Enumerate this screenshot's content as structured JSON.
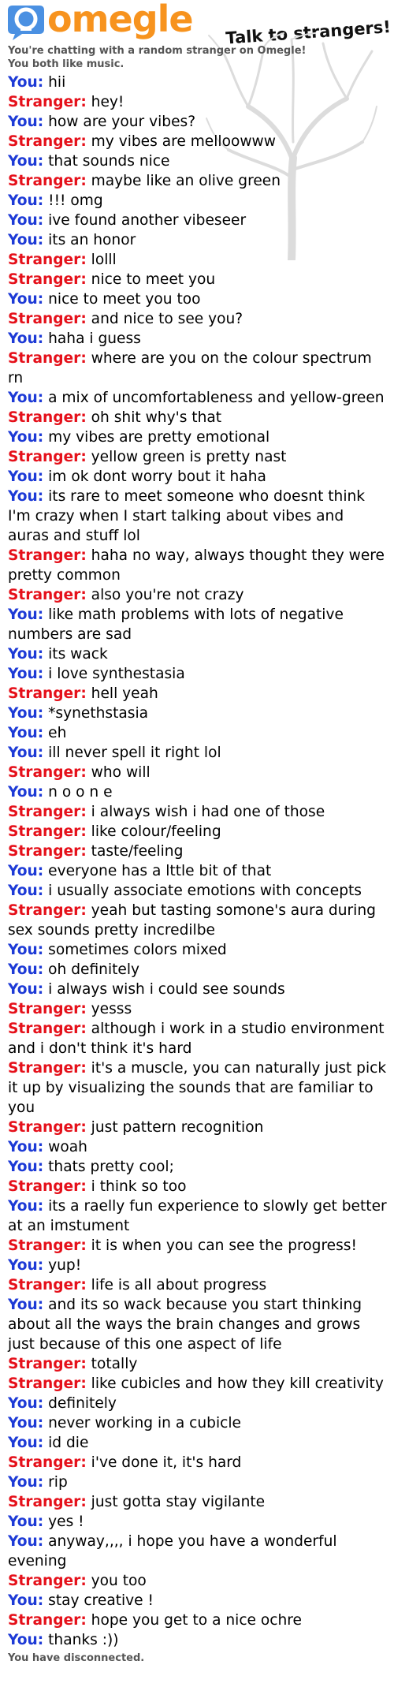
{
  "header": {
    "logo_text": "omegle",
    "tagline": "Talk to strangers!"
  },
  "system": {
    "intro": "You're chatting with a random stranger on Omegle!",
    "common_interest": "You both like music.",
    "disconnected": "You have disconnected."
  },
  "labels": {
    "you": "You:",
    "stranger": "Stranger:"
  },
  "colors": {
    "you": "#1d3ad6",
    "stranger": "#e5101a",
    "logo": "#f7931e",
    "logo_bubble": "#4a90e2"
  },
  "messages": [
    {
      "from": "you",
      "text": "hii"
    },
    {
      "from": "stranger",
      "text": "hey!"
    },
    {
      "from": "you",
      "text": "how are your vibes?"
    },
    {
      "from": "stranger",
      "text": "my vibes are melloowww"
    },
    {
      "from": "you",
      "text": "that sounds nice"
    },
    {
      "from": "stranger",
      "text": "maybe like an olive green"
    },
    {
      "from": "you",
      "text": "!!! omg"
    },
    {
      "from": "you",
      "text": "ive found another vibeseer"
    },
    {
      "from": "you",
      "text": "its an honor"
    },
    {
      "from": "stranger",
      "text": "lolll"
    },
    {
      "from": "stranger",
      "text": "nice to meet you"
    },
    {
      "from": "you",
      "text": "nice to meet you too"
    },
    {
      "from": "stranger",
      "text": "and nice to see you?"
    },
    {
      "from": "you",
      "text": "haha i guess"
    },
    {
      "from": "stranger",
      "text": "where are you on the colour spectrum rn"
    },
    {
      "from": "you",
      "text": "a mix of uncomfortableness and yellow-green"
    },
    {
      "from": "stranger",
      "text": "oh shit why's that"
    },
    {
      "from": "you",
      "text": "my vibes are pretty emotional"
    },
    {
      "from": "stranger",
      "text": "yellow green is pretty nast"
    },
    {
      "from": "you",
      "text": "im ok dont worry bout it haha"
    },
    {
      "from": "you",
      "text": "its rare to meet someone who doesnt think I'm crazy when I start talking about vibes and auras and stuff lol"
    },
    {
      "from": "stranger",
      "text": "haha no way, always thought they were pretty common"
    },
    {
      "from": "stranger",
      "text": "also you're not crazy"
    },
    {
      "from": "you",
      "text": "like math problems with lots of negative numbers are sad"
    },
    {
      "from": "you",
      "text": "its wack"
    },
    {
      "from": "you",
      "text": "i love synthestasia"
    },
    {
      "from": "stranger",
      "text": "hell yeah"
    },
    {
      "from": "you",
      "text": "*synethstasia"
    },
    {
      "from": "you",
      "text": "eh"
    },
    {
      "from": "you",
      "text": "ill never spell it right lol"
    },
    {
      "from": "stranger",
      "text": "who will"
    },
    {
      "from": "you",
      "text": "n o o n e"
    },
    {
      "from": "stranger",
      "text": "i always wish i had one of those"
    },
    {
      "from": "stranger",
      "text": "like colour/feeling"
    },
    {
      "from": "stranger",
      "text": "taste/feeling"
    },
    {
      "from": "you",
      "text": "everyone has a lttle bit of that"
    },
    {
      "from": "you",
      "text": "i usually associate emotions with concepts"
    },
    {
      "from": "stranger",
      "text": "yeah but tasting somone's aura during sex sounds pretty incredilbe"
    },
    {
      "from": "you",
      "text": "sometimes colors mixed"
    },
    {
      "from": "you",
      "text": "oh definitely"
    },
    {
      "from": "you",
      "text": "i always wish i could see sounds"
    },
    {
      "from": "stranger",
      "text": "yesss"
    },
    {
      "from": "stranger",
      "text": "although i work in a studio environment and i don't think it's hard"
    },
    {
      "from": "stranger",
      "text": "it's a muscle, you can naturally just pick it up by visualizing the sounds that are familiar to you"
    },
    {
      "from": "stranger",
      "text": "just pattern recognition"
    },
    {
      "from": "you",
      "text": "woah"
    },
    {
      "from": "you",
      "text": "thats pretty cool;"
    },
    {
      "from": "stranger",
      "text": "i think so too"
    },
    {
      "from": "you",
      "text": "its a raelly fun experience to slowly get better at an imstument"
    },
    {
      "from": "stranger",
      "text": "it is when you can see the progress!"
    },
    {
      "from": "you",
      "text": "yup!"
    },
    {
      "from": "stranger",
      "text": "life is all about progress"
    },
    {
      "from": "you",
      "text": "and its so wack because you start thinking about all the ways the brain changes and grows just because of this one aspect of life"
    },
    {
      "from": "stranger",
      "text": "totally"
    },
    {
      "from": "stranger",
      "text": "like cubicles and how they kill creativity"
    },
    {
      "from": "you",
      "text": "definitely"
    },
    {
      "from": "you",
      "text": "never working in a cubicle"
    },
    {
      "from": "you",
      "text": "id die"
    },
    {
      "from": "stranger",
      "text": "i've done it, it's hard"
    },
    {
      "from": "you",
      "text": "rip"
    },
    {
      "from": "stranger",
      "text": "just gotta stay vigilante"
    },
    {
      "from": "you",
      "text": "yes !"
    },
    {
      "from": "you",
      "text": "anyway,,,, i hope you have a wonderful evening"
    },
    {
      "from": "stranger",
      "text": "you too"
    },
    {
      "from": "you",
      "text": "stay creative !"
    },
    {
      "from": "stranger",
      "text": "hope you get to a nice ochre"
    },
    {
      "from": "you",
      "text": "thanks :))"
    }
  ]
}
